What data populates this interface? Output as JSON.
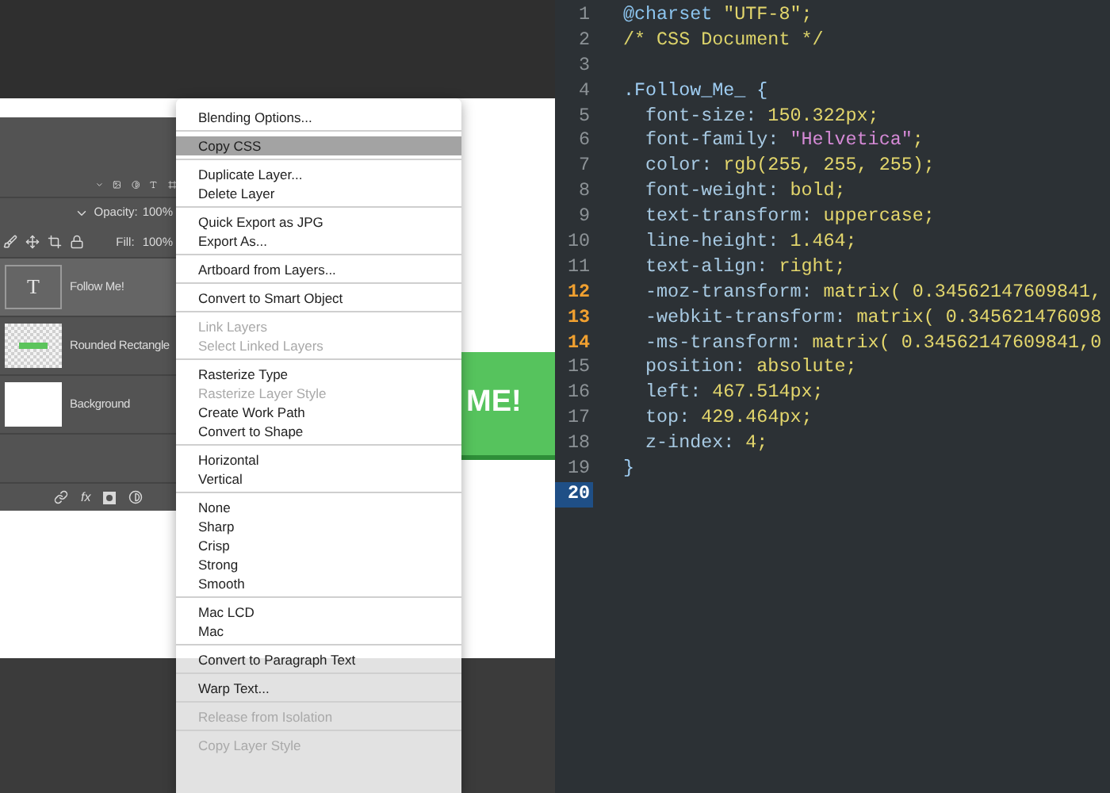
{
  "layers_panel": {
    "opacity_label": "Opacity:",
    "opacity": "100%",
    "fill_label": "Fill:",
    "fill": "100%",
    "effects_label": "fx",
    "layers": [
      {
        "name": "Follow Me!",
        "kind": "text",
        "glyph": "T",
        "selected": true
      },
      {
        "name": "Rounded Rectangle",
        "kind": "shape",
        "selected": false
      },
      {
        "name": "Background",
        "kind": "fill",
        "selected": false
      }
    ]
  },
  "canvas": {
    "button_text": "ME!"
  },
  "context_menu": {
    "groups": [
      [
        {
          "label": "Blending Options...",
          "disabled": false,
          "selected": false
        }
      ],
      [
        {
          "label": "Copy CSS",
          "disabled": false,
          "selected": true
        }
      ],
      [
        {
          "label": "Duplicate Layer...",
          "disabled": false,
          "selected": false
        },
        {
          "label": "Delete Layer",
          "disabled": false,
          "selected": false
        }
      ],
      [
        {
          "label": "Quick Export as JPG",
          "disabled": false,
          "selected": false
        },
        {
          "label": "Export As...",
          "disabled": false,
          "selected": false
        }
      ],
      [
        {
          "label": "Artboard from Layers...",
          "disabled": false,
          "selected": false
        }
      ],
      [
        {
          "label": "Convert to Smart Object",
          "disabled": false,
          "selected": false
        }
      ],
      [
        {
          "label": "Link Layers",
          "disabled": true,
          "selected": false
        },
        {
          "label": "Select Linked Layers",
          "disabled": true,
          "selected": false
        }
      ],
      [
        {
          "label": "Rasterize Type",
          "disabled": false,
          "selected": false
        },
        {
          "label": "Rasterize Layer Style",
          "disabled": true,
          "selected": false
        },
        {
          "label": "Create Work Path",
          "disabled": false,
          "selected": false
        },
        {
          "label": "Convert to Shape",
          "disabled": false,
          "selected": false
        }
      ],
      [
        {
          "label": "Horizontal",
          "disabled": false,
          "selected": false
        },
        {
          "label": "Vertical",
          "disabled": false,
          "selected": false
        }
      ],
      [
        {
          "label": "None",
          "disabled": false,
          "selected": false
        },
        {
          "label": "Sharp",
          "disabled": false,
          "selected": false
        },
        {
          "label": "Crisp",
          "disabled": false,
          "selected": false
        },
        {
          "label": "Strong",
          "disabled": false,
          "selected": false
        },
        {
          "label": "Smooth",
          "disabled": false,
          "selected": false
        }
      ],
      [
        {
          "label": "Mac LCD",
          "disabled": false,
          "selected": false
        },
        {
          "label": "Mac",
          "disabled": false,
          "selected": false
        }
      ],
      [
        {
          "label": "Convert to Paragraph Text",
          "disabled": false,
          "selected": false
        }
      ],
      [
        {
          "label": "Warp Text...",
          "disabled": false,
          "selected": false
        }
      ],
      [
        {
          "label": "Release from Isolation",
          "disabled": true,
          "selected": false
        }
      ],
      [
        {
          "label": "Copy Layer Style",
          "disabled": true,
          "selected": false
        }
      ]
    ]
  },
  "editor": {
    "lines": [
      {
        "number": "1",
        "modified": false,
        "current": false,
        "tokens": [
          {
            "text": "@charset",
            "kind": "at"
          },
          {
            "text": " \"UTF-8\";",
            "kind": "val"
          }
        ]
      },
      {
        "number": "2",
        "modified": false,
        "current": false,
        "tokens": [
          {
            "text": "/* CSS Document */",
            "kind": "comment"
          }
        ]
      },
      {
        "number": "3",
        "modified": false,
        "current": false
      },
      {
        "number": "4",
        "modified": false,
        "current": false,
        "tokens": [
          {
            "text": ".Follow_Me_ {",
            "kind": "sel"
          }
        ]
      },
      {
        "number": "5",
        "modified": false,
        "current": false,
        "tokens": [
          {
            "text": "  font-size:",
            "kind": "prop"
          },
          {
            "text": " 150.322px;",
            "kind": "val"
          }
        ]
      },
      {
        "number": "6",
        "modified": false,
        "current": false,
        "tokens": [
          {
            "text": "  font-family:",
            "kind": "prop"
          },
          {
            "text": " \"Helvetica\"",
            "kind": "quote"
          },
          {
            "text": ";",
            "kind": "val"
          }
        ]
      },
      {
        "number": "7",
        "modified": false,
        "current": false,
        "tokens": [
          {
            "text": "  color:",
            "kind": "prop"
          },
          {
            "text": " rgb(255, 255, 255);",
            "kind": "val"
          }
        ]
      },
      {
        "number": "8",
        "modified": false,
        "current": false,
        "tokens": [
          {
            "text": "  font-weight:",
            "kind": "prop"
          },
          {
            "text": " bold;",
            "kind": "val"
          }
        ]
      },
      {
        "number": "9",
        "modified": false,
        "current": false,
        "tokens": [
          {
            "text": "  text-transform:",
            "kind": "prop"
          },
          {
            "text": " uppercase;",
            "kind": "val"
          }
        ]
      },
      {
        "number": "10",
        "modified": false,
        "current": false,
        "tokens": [
          {
            "text": "  line-height:",
            "kind": "prop"
          },
          {
            "text": " 1.464;",
            "kind": "val"
          }
        ]
      },
      {
        "number": "11",
        "modified": false,
        "current": false,
        "tokens": [
          {
            "text": "  text-align:",
            "kind": "prop"
          },
          {
            "text": " right;",
            "kind": "val"
          }
        ]
      },
      {
        "number": "12",
        "modified": true,
        "current": false,
        "tokens": [
          {
            "text": "  -moz-transform:",
            "kind": "prop"
          },
          {
            "text": " matrix( 0.34562147609841,",
            "kind": "val"
          }
        ]
      },
      {
        "number": "13",
        "modified": true,
        "current": false,
        "tokens": [
          {
            "text": "  -webkit-transform:",
            "kind": "prop"
          },
          {
            "text": " matrix( 0.345621476098",
            "kind": "val"
          }
        ]
      },
      {
        "number": "14",
        "modified": true,
        "current": false,
        "tokens": [
          {
            "text": "  -ms-transform:",
            "kind": "prop"
          },
          {
            "text": " matrix( 0.34562147609841,0",
            "kind": "val"
          }
        ]
      },
      {
        "number": "15",
        "modified": false,
        "current": false,
        "tokens": [
          {
            "text": "  position:",
            "kind": "prop"
          },
          {
            "text": " absolute;",
            "kind": "val"
          }
        ]
      },
      {
        "number": "16",
        "modified": false,
        "current": false,
        "tokens": [
          {
            "text": "  left:",
            "kind": "prop"
          },
          {
            "text": " 467.514px;",
            "kind": "val"
          }
        ]
      },
      {
        "number": "17",
        "modified": false,
        "current": false,
        "tokens": [
          {
            "text": "  top:",
            "kind": "prop"
          },
          {
            "text": " 429.464px;",
            "kind": "val"
          }
        ]
      },
      {
        "number": "18",
        "modified": false,
        "current": false,
        "tokens": [
          {
            "text": "  z-index:",
            "kind": "prop"
          },
          {
            "text": " 4;",
            "kind": "val"
          }
        ]
      },
      {
        "number": "19",
        "modified": false,
        "current": false,
        "tokens": [
          {
            "text": "}",
            "kind": "sel"
          }
        ]
      },
      {
        "number": "20",
        "modified": false,
        "current": true
      }
    ]
  }
}
